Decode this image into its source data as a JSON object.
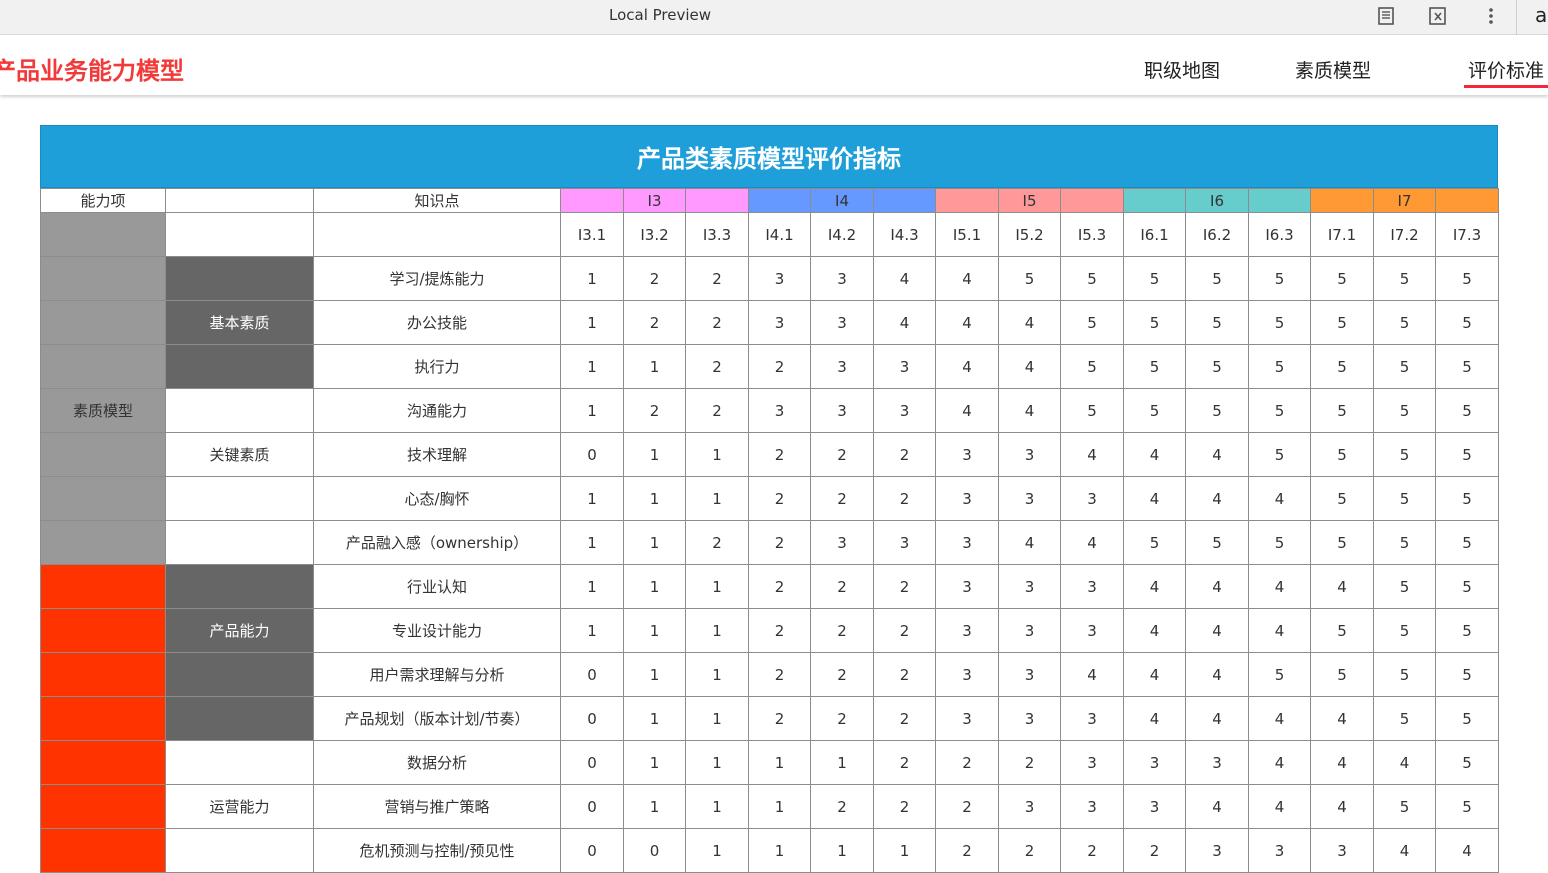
{
  "browser": {
    "title": "Local Preview",
    "right_letter": "a",
    "icons": [
      "reader-icon",
      "clear-icon",
      "more-vert-icon"
    ]
  },
  "app": {
    "title": "产品业务能力模型",
    "nav": [
      {
        "label": "职级地图",
        "active": false
      },
      {
        "label": "素质模型",
        "active": false
      },
      {
        "label": "评价标准",
        "active": true
      }
    ],
    "accent_color": "#f23a3a"
  },
  "table": {
    "title": "产品类素质模型评价指标",
    "header": {
      "col1": "能力项",
      "col2": "",
      "col3": "知识点",
      "groups": [
        {
          "label": "I3",
          "color": "#ff99ff"
        },
        {
          "label": "I4",
          "color": "#6699ff"
        },
        {
          "label": "I5",
          "color": "#ff9999"
        },
        {
          "label": "I6",
          "color": "#66cccc"
        },
        {
          "label": "I7",
          "color": "#ff9933"
        }
      ],
      "levels": [
        "I3.1",
        "I3.2",
        "I3.3",
        "I4.1",
        "I4.2",
        "I4.3",
        "I5.1",
        "I5.2",
        "I5.3",
        "I6.1",
        "I6.2",
        "I6.3",
        "I7.1",
        "I7.2",
        "I7.3"
      ]
    },
    "rows": [
      {
        "cat": "",
        "cat_color": "grey",
        "sub": "",
        "sub_color": "dark",
        "item": "学习/提炼能力",
        "values": [
          1,
          2,
          2,
          3,
          3,
          4,
          4,
          5,
          5,
          5,
          5,
          5,
          5,
          5,
          5
        ]
      },
      {
        "cat": "",
        "cat_color": "grey",
        "sub": "基本素质",
        "sub_color": "dark",
        "item": "办公技能",
        "values": [
          1,
          2,
          2,
          3,
          3,
          4,
          4,
          4,
          5,
          5,
          5,
          5,
          5,
          5,
          5
        ]
      },
      {
        "cat": "",
        "cat_color": "grey",
        "sub": "",
        "sub_color": "dark",
        "item": "执行力",
        "values": [
          1,
          1,
          2,
          2,
          3,
          3,
          4,
          4,
          5,
          5,
          5,
          5,
          5,
          5,
          5
        ]
      },
      {
        "cat": "素质模型",
        "cat_color": "grey",
        "sub": "",
        "sub_color": "white",
        "item": "沟通能力",
        "values": [
          1,
          2,
          2,
          3,
          3,
          3,
          4,
          4,
          5,
          5,
          5,
          5,
          5,
          5,
          5
        ]
      },
      {
        "cat": "",
        "cat_color": "grey",
        "sub": "关键素质",
        "sub_color": "white",
        "item": "技术理解",
        "values": [
          0,
          1,
          1,
          2,
          2,
          2,
          3,
          3,
          4,
          4,
          4,
          5,
          5,
          5,
          5
        ]
      },
      {
        "cat": "",
        "cat_color": "grey",
        "sub": "",
        "sub_color": "white",
        "item": "心态/胸怀",
        "values": [
          1,
          1,
          1,
          2,
          2,
          2,
          3,
          3,
          3,
          4,
          4,
          4,
          5,
          5,
          5
        ]
      },
      {
        "cat": "",
        "cat_color": "grey",
        "sub": "",
        "sub_color": "white",
        "item": "产品融入感（ownership）",
        "values": [
          1,
          1,
          2,
          2,
          3,
          3,
          3,
          4,
          4,
          5,
          5,
          5,
          5,
          5,
          5
        ]
      },
      {
        "cat": "",
        "cat_color": "red",
        "sub": "",
        "sub_color": "dark",
        "item": "行业认知",
        "values": [
          1,
          1,
          1,
          2,
          2,
          2,
          3,
          3,
          3,
          4,
          4,
          4,
          4,
          5,
          5
        ]
      },
      {
        "cat": "",
        "cat_color": "red",
        "sub": "产品能力",
        "sub_color": "dark",
        "item": "专业设计能力",
        "values": [
          1,
          1,
          1,
          2,
          2,
          2,
          3,
          3,
          3,
          4,
          4,
          4,
          5,
          5,
          5
        ]
      },
      {
        "cat": "",
        "cat_color": "red",
        "sub": "",
        "sub_color": "dark",
        "item": "用户需求理解与分析",
        "values": [
          0,
          1,
          1,
          2,
          2,
          2,
          3,
          3,
          4,
          4,
          4,
          5,
          5,
          5,
          5
        ]
      },
      {
        "cat": "",
        "cat_color": "red",
        "sub": "",
        "sub_color": "dark",
        "item": "产品规划（版本计划/节奏）",
        "values": [
          0,
          1,
          1,
          2,
          2,
          2,
          3,
          3,
          3,
          4,
          4,
          4,
          4,
          5,
          5
        ]
      },
      {
        "cat": "",
        "cat_color": "red",
        "sub": "",
        "sub_color": "white",
        "item": "数据分析",
        "values": [
          0,
          1,
          1,
          1,
          1,
          2,
          2,
          2,
          3,
          3,
          3,
          4,
          4,
          4,
          5
        ]
      },
      {
        "cat": "",
        "cat_color": "red",
        "sub": "运营能力",
        "sub_color": "white",
        "item": "营销与推广策略",
        "values": [
          0,
          1,
          1,
          1,
          2,
          2,
          2,
          3,
          3,
          3,
          4,
          4,
          4,
          5,
          5
        ]
      },
      {
        "cat": "",
        "cat_color": "red",
        "sub": "",
        "sub_color": "white",
        "item": "危机预测与控制/预见性",
        "values": [
          0,
          0,
          1,
          1,
          1,
          1,
          2,
          2,
          2,
          2,
          3,
          3,
          3,
          4,
          4
        ]
      }
    ]
  }
}
